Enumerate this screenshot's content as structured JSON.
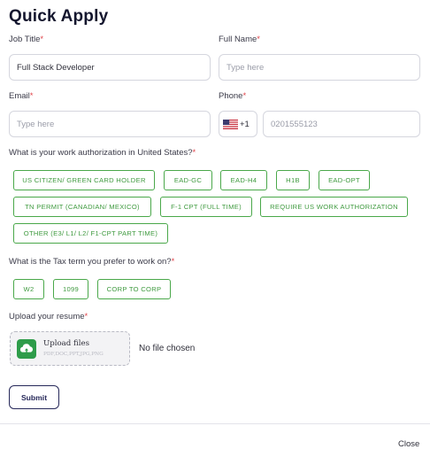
{
  "dialog": {
    "title": "Quick Apply"
  },
  "fields": {
    "job_title": {
      "label": "Job Title",
      "required_mark": "*",
      "value": "Full Stack Developer"
    },
    "full_name": {
      "label": "Full Name",
      "required_mark": "*",
      "placeholder": "Type here"
    },
    "email": {
      "label": "Email",
      "required_mark": "*",
      "placeholder": "Type here"
    },
    "phone": {
      "label": "Phone",
      "required_mark": "*",
      "country_code": "+1",
      "country_flag": "us-flag-icon",
      "placeholder": "0201555123"
    }
  },
  "work_authorization": {
    "question": "What is your work authorization in United States?",
    "required_mark": "*",
    "options": [
      "US CITIZEN/ GREEN CARD HOLDER",
      "EAD-GC",
      "EAD-H4",
      "H1B",
      "EAD-OPT",
      "TN PERMIT (CANADIAN/ MEXICO)",
      "F-1 CPT (FULL TIME)",
      "REQUIRE US WORK AUTHORIZATION",
      "OTHER (E3/ L1/ L2/ F1-CPT PART TIME)"
    ]
  },
  "tax_term": {
    "question": "What is the Tax term you prefer to work on?",
    "required_mark": "*",
    "options": [
      "W2",
      "1099",
      "CORP TO CORP"
    ]
  },
  "resume": {
    "label": "Upload your resume",
    "required_mark": "*",
    "upload_title": "Upload files",
    "upload_types": "PDF,DOC,PPT,JPG,PNG",
    "upload_icon": "cloud-upload-icon",
    "file_status": "No file chosen"
  },
  "actions": {
    "submit_label": "Submit",
    "close_label": "Close"
  },
  "colors": {
    "accent_green": "#4aa84a",
    "title": "#14162e",
    "required": "#e0454b",
    "submit_border": "#27295a"
  }
}
